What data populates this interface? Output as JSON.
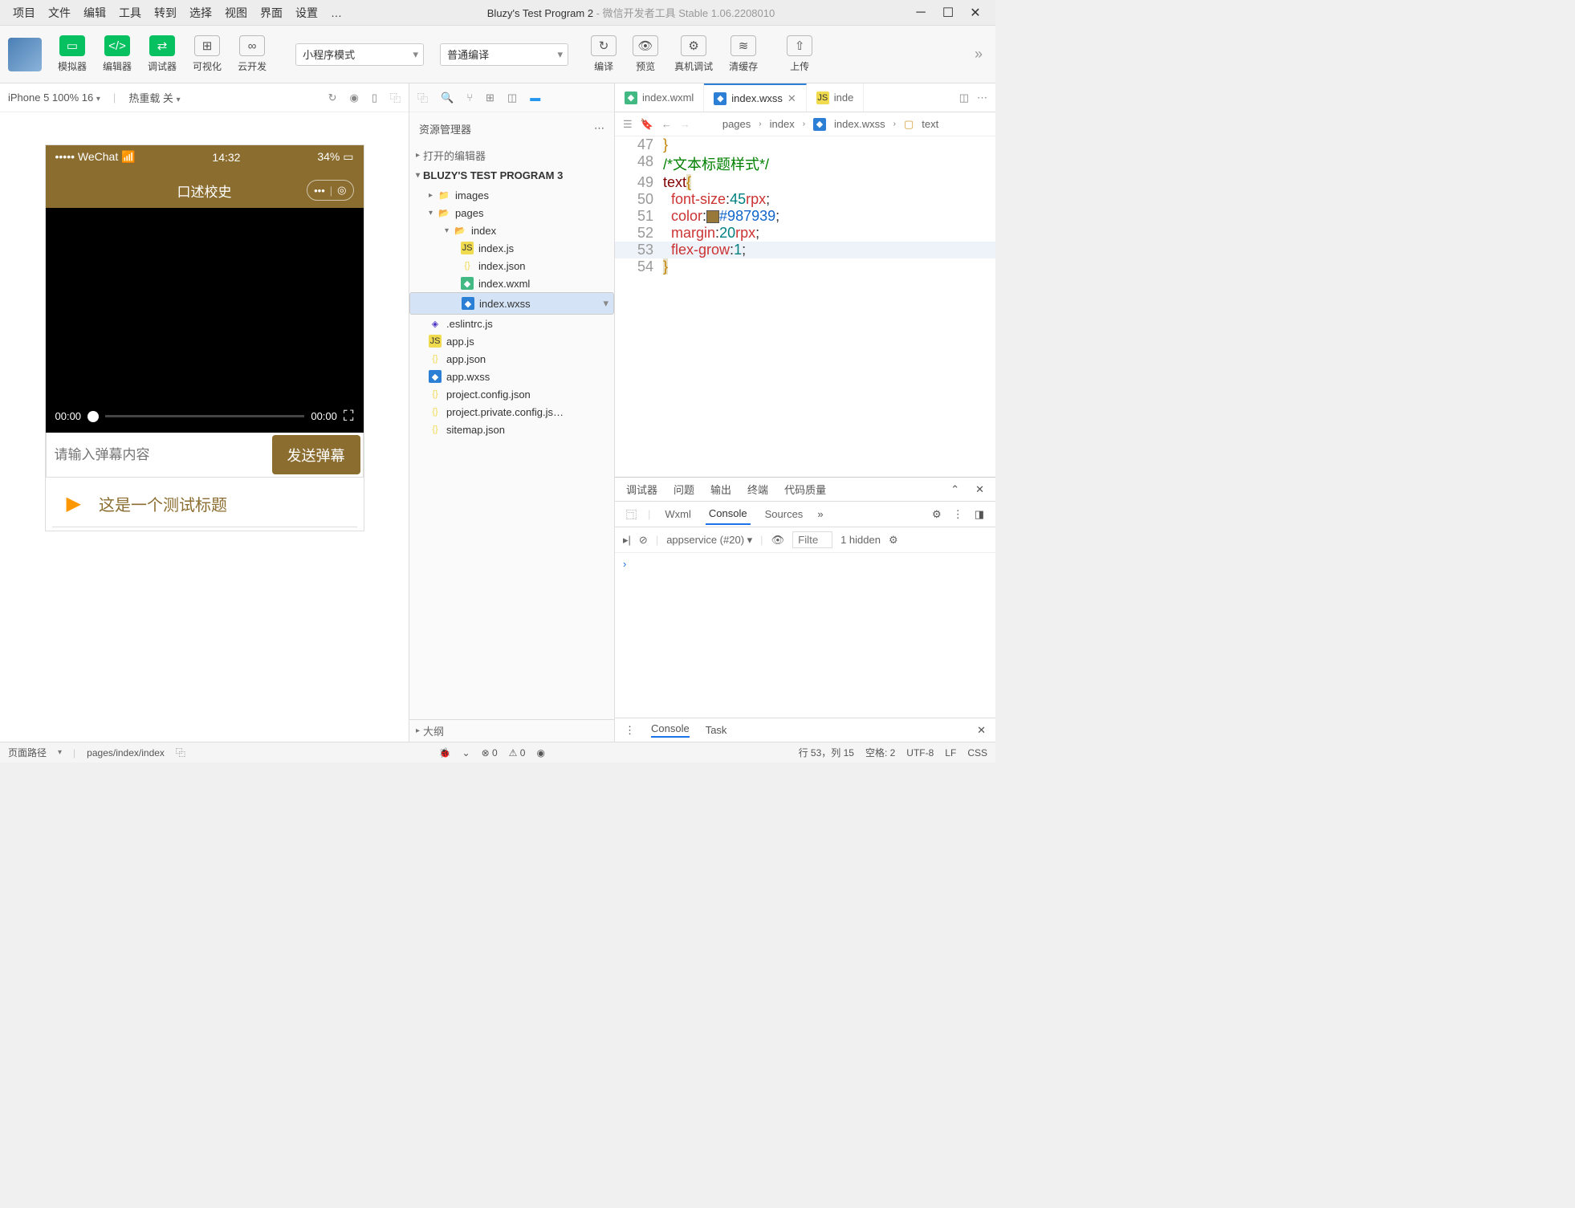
{
  "menu": {
    "items": [
      "项目",
      "文件",
      "编辑",
      "工具",
      "转到",
      "选择",
      "视图",
      "界面",
      "设置",
      "…"
    ],
    "title": "Bluzy's Test Program 2",
    "subtitle": " - 微信开发者工具 Stable 1.06.2208010"
  },
  "toolbar": {
    "simulator": "模拟器",
    "editor": "编辑器",
    "debugger": "调试器",
    "visual": "可视化",
    "cloud": "云开发",
    "mode": "小程序模式",
    "compile_mode": "普通编译",
    "compile": "编译",
    "preview": "预览",
    "realdebug": "真机调试",
    "cache": "清缓存",
    "upload": "上传"
  },
  "simbar": {
    "device": "iPhone 5 100% 16",
    "reload": "热重载 关"
  },
  "phone": {
    "carrier": "••••• WeChat",
    "time": "14:32",
    "battery": "34%",
    "title": "口述校史",
    "t0": "00:00",
    "t1": "00:00",
    "input_ph": "请输入弹幕内容",
    "send": "发送弹幕",
    "item": "这是一个测试标题"
  },
  "explorer": {
    "title": "资源管理器",
    "open_editors": "打开的编辑器",
    "project": "BLUZY'S TEST PROGRAM 3",
    "outline": "大纲",
    "tree": {
      "images": "images",
      "pages": "pages",
      "index": "index",
      "indexjs": "index.js",
      "indexjson": "index.json",
      "indexwxml": "index.wxml",
      "indexwxss": "index.wxss",
      "eslint": ".eslintrc.js",
      "appjs": "app.js",
      "appjson": "app.json",
      "appwxss": "app.wxss",
      "pcfg": "project.config.json",
      "ppcfg": "project.private.config.js…",
      "site": "sitemap.json"
    }
  },
  "tabs": {
    "t1": "index.wxml",
    "t2": "index.wxss",
    "t3": "inde"
  },
  "crumb": {
    "p1": "pages",
    "p2": "index",
    "p3": "index.wxss",
    "p4": "text"
  },
  "code": {
    "l47": "}",
    "l48": "/*文本标题样式*/",
    "l49a": "text",
    "l49b": "{",
    "l50a": "font-size",
    "l50b": "45",
    "l50c": "rpx",
    "l51a": "color",
    "l51b": "#987939",
    "l52a": "margin",
    "l52b": "20",
    "l52c": "rpx",
    "l53a": "flex-grow",
    "l53b": "1",
    "l54": "}"
  },
  "devtools": {
    "t1": "调试器",
    "t2": "问题",
    "t3": "输出",
    "t4": "终端",
    "t5": "代码质量",
    "i1": "Wxml",
    "i2": "Console",
    "i3": "Sources",
    "scope": "appservice (#20)",
    "filter_ph": "Filte",
    "hidden": "1 hidden",
    "f1": "Console",
    "f2": "Task"
  },
  "status": {
    "path_label": "页面路径",
    "path": "pages/index/index",
    "err": "0",
    "warn": "0",
    "pos": "行 53，列 15",
    "spaces": "空格: 2",
    "enc": "UTF-8",
    "eol": "LF",
    "lang": "CSS"
  }
}
